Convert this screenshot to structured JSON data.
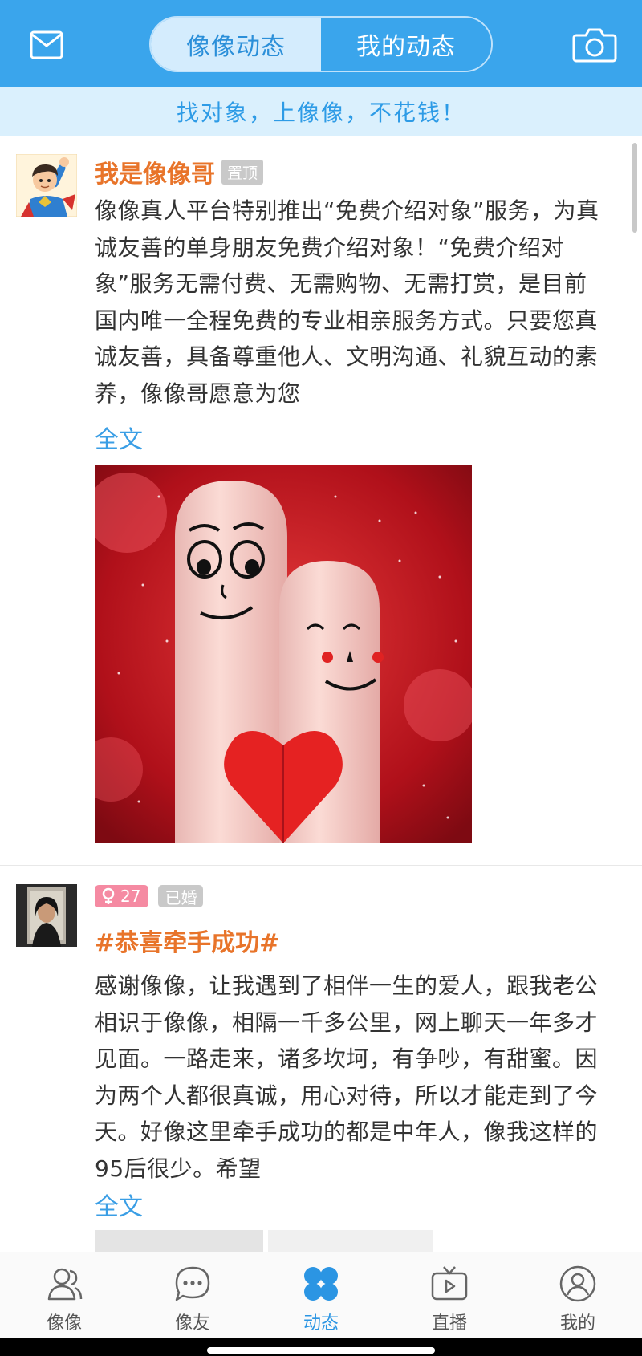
{
  "header": {
    "tabs": [
      {
        "label": "像像动态",
        "active": true
      },
      {
        "label": "我的动态",
        "active": false
      }
    ],
    "mail_icon": "mail-icon",
    "camera_icon": "camera-icon"
  },
  "banner": {
    "text": "找对象，上像像，不花钱！"
  },
  "posts": [
    {
      "author": "我是像像哥",
      "pin_label": "置顶",
      "text": "像像真人平台特别推出“免费介绍对象”服务，为真诚友善的单身朋友免费介绍对象！“免费介绍对象”服务无需付费、无需购物、无需打赏，是目前国内唯一全程免费的专业相亲服务方式。只要您真诚友善，具备尊重他人、文明沟通、礼貌互动的素养，像像哥愿意为您",
      "full_text_link": "全文",
      "image": "finger-couple-photo"
    },
    {
      "age": "27",
      "status": "已婚",
      "topic": "#恭喜牵手成功#",
      "text": "感谢像像，让我遇到了相伴一生的爱人，跟我老公相识于像像，相隔一千多公里，网上聊天一年多才见面。一路走来，诸多坎坷，有争吵，有甜蜜。因为两个人都很真诚，用心对待，所以才能走到了今天。好像这里牵手成功的都是中年人，像我这样的95后很少。希望",
      "full_text_link": "全文"
    }
  ],
  "bottom_nav": [
    {
      "label": "像像",
      "icon": "people-icon",
      "active": false
    },
    {
      "label": "像友",
      "icon": "chat-bubble-icon",
      "active": false
    },
    {
      "label": "动态",
      "icon": "dynamics-icon",
      "active": true
    },
    {
      "label": "直播",
      "icon": "live-tv-icon",
      "active": false
    },
    {
      "label": "我的",
      "icon": "profile-icon",
      "active": false
    }
  ],
  "colors": {
    "header_bg": "#3aa5ec",
    "banner_bg": "#daf0fd",
    "accent_orange": "#e8742a",
    "link_blue": "#3a9ee5",
    "nav_active": "#2b95e3"
  }
}
